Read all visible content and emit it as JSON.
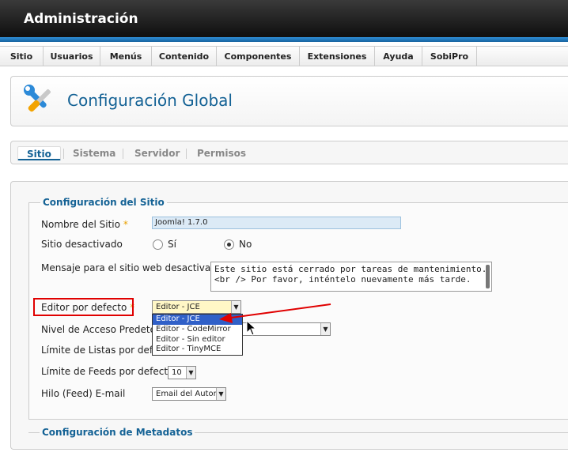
{
  "header": {
    "title": "Administración"
  },
  "menu": {
    "items": [
      {
        "label": "Sitio"
      },
      {
        "label": "Usuarios"
      },
      {
        "label": "Menús"
      },
      {
        "label": "Contenido"
      },
      {
        "label": "Componentes"
      },
      {
        "label": "Extensiones"
      },
      {
        "label": "Ayuda"
      },
      {
        "label": "SobiPro"
      }
    ]
  },
  "page": {
    "title": "Configuración Global",
    "icon": "tools-icon"
  },
  "tabs": [
    {
      "label": "Sitio",
      "active": true
    },
    {
      "label": "Sistema",
      "active": false
    },
    {
      "label": "Servidor",
      "active": false
    },
    {
      "label": "Permisos",
      "active": false
    }
  ],
  "site_config": {
    "legend": "Configuración del Sitio",
    "site_name": {
      "label": "Nombre del Sitio",
      "required": "*",
      "value": "Joomla! 1.7.0"
    },
    "offline": {
      "label": "Sitio desactivado",
      "yes": "Sí",
      "no": "No",
      "selected": "No"
    },
    "offline_message": {
      "label": "Mensaje para el sitio web desactivado",
      "value": "Este sitio está cerrado por tareas de mantenimiento.<br /> Por favor, inténtelo nuevamente más tarde."
    },
    "editor": {
      "label": "Editor por defecto",
      "required": "*",
      "value": "Editor - JCE",
      "options": [
        "Editor - JCE",
        "Editor - CodeMirror",
        "Editor - Sin editor",
        "Editor - TinyMCE"
      ],
      "selected_index": 0
    },
    "access_level": {
      "label": "Nivel de Acceso Predeterm"
    },
    "list_limit": {
      "label": "Límite de Listas por defecto"
    },
    "feed_limit": {
      "label": "Límite de Feeds por defecto",
      "value": "10"
    },
    "feed_email": {
      "label": "Hilo (Feed) E-mail",
      "value": "Email del Autor"
    }
  },
  "metadata_config": {
    "legend": "Configuración de Metadatos"
  },
  "colors": {
    "accent": "#146295",
    "header_bar": "#1f7ac1",
    "highlight": "#e00000",
    "dropdown_selected": "#3060c8"
  }
}
